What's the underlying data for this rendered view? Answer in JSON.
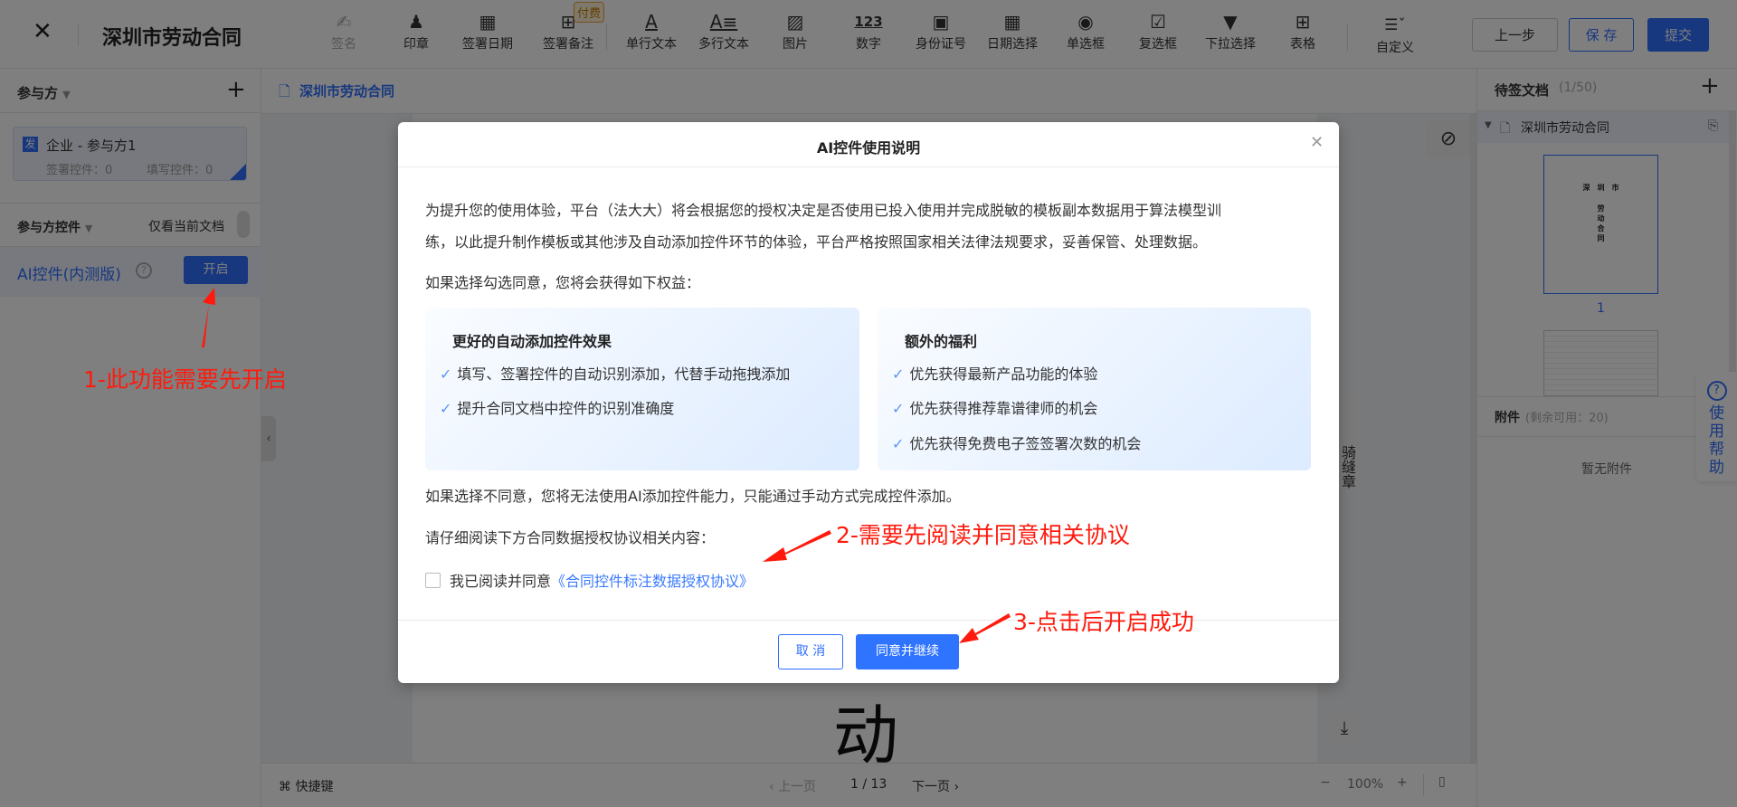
{
  "header": {
    "title": "深圳市劳动合同",
    "tools": [
      {
        "label": "签名",
        "icon": "pen-sign-icon",
        "disabled": true
      },
      {
        "label": "印章",
        "icon": "stamp-icon"
      },
      {
        "label": "签署日期",
        "icon": "calendar-icon"
      },
      {
        "label": "签署备注",
        "icon": "note-add-icon",
        "badge": "付费"
      },
      {
        "label": "单行文本",
        "icon": "text-single-icon"
      },
      {
        "label": "多行文本",
        "icon": "text-multi-icon"
      },
      {
        "label": "图片",
        "icon": "image-icon"
      },
      {
        "label": "数字",
        "icon": "number-icon"
      },
      {
        "label": "身份证号",
        "icon": "id-card-icon"
      },
      {
        "label": "日期选择",
        "icon": "date-picker-icon"
      },
      {
        "label": "单选框",
        "icon": "radio-icon"
      },
      {
        "label": "复选框",
        "icon": "checkbox-icon"
      },
      {
        "label": "下拉选择",
        "icon": "dropdown-icon"
      },
      {
        "label": "表格",
        "icon": "table-icon"
      },
      {
        "label": "自定义",
        "icon": "custom-icon"
      }
    ],
    "prev_label": "上一步",
    "save_label": "保 存",
    "submit_label": "提交"
  },
  "sidebar": {
    "parties_title": "参与方",
    "party": {
      "badge": "发",
      "name": "企业 - 参与方1",
      "sign_count": "签署控件：0",
      "fill_count": "填写控件：0"
    },
    "controls_title": "参与方控件",
    "only_current": "仅看当前文档",
    "ai_label": "AI控件(内测版)",
    "ai_button": "开启"
  },
  "center": {
    "doc_tab": "深圳市劳动合同",
    "page_char": "动",
    "seam_seal": "骑缝章"
  },
  "bottombar": {
    "shortcut": "快捷键",
    "prev_page": "上一页",
    "page_indicator": "1 / 13",
    "next_page": "下一页",
    "zoom": "100%",
    "minus": "−",
    "plus": "+"
  },
  "rightpanel": {
    "title": "待签文档",
    "count": "(1/50)",
    "doc_name": "深圳市劳动合同",
    "thumb_page": "1",
    "thumb_title": "深　圳　市",
    "thumb_chars": [
      "劳",
      "动",
      "合",
      "同"
    ],
    "attach_title": "附件",
    "attach_count": "(剩余可用：20)",
    "no_attach": "暂无附件",
    "help": "使用帮助"
  },
  "modal": {
    "title": "AI控件使用说明",
    "intro_line1": "为提升您的使用体验，平台（法大大）将会根据您的授权决定是否使用已投入使用并完成脱敏的模板副本数据用于算法模型训",
    "intro_line2": "练，以此提升制作模板或其他涉及自动添加控件环节的体验，平台严格按照国家相关法律法规要求，妥善保管、处理数据。",
    "if_agree": "如果选择勾选同意，您将会获得如下权益：",
    "card1": {
      "title": "更好的自动添加控件效果",
      "items": [
        "填写、签署控件的自动识别添加，代替手动拖拽添加",
        "提升合同文档中控件的识别准确度"
      ]
    },
    "card2": {
      "title": "额外的福利",
      "items": [
        "优先获得最新产品功能的体验",
        "优先获得推荐靠谱律师的机会",
        "优先获得免费电子签签署次数的机会"
      ]
    },
    "if_disagree": "如果选择不同意，您将无法使用AI添加控件能力，只能通过手动方式完成控件添加。",
    "read_prompt": "请仔细阅读下方合同数据授权协议相关内容：",
    "agree_text": "我已阅读并同意",
    "agreement_link": "《合同控件标注数据授权协议》",
    "agree_checked": false,
    "cancel": "取 消",
    "confirm": "同意并继续"
  },
  "annotations": [
    "1-此功能需要先开启",
    "2-需要先阅读并同意相关协议",
    "3-点击后开启成功"
  ],
  "colors": {
    "primary": "#2f6fff",
    "link": "#3a7afe",
    "annotation": "#ff1a0d",
    "check": "#5b95f5"
  }
}
